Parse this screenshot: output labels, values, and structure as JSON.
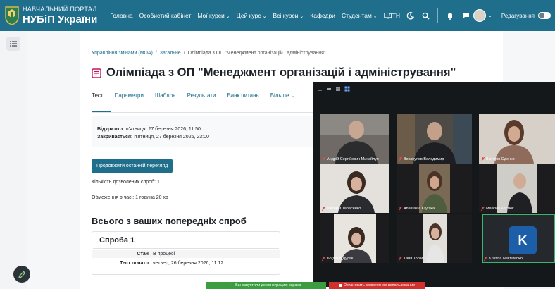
{
  "header": {
    "logo_top": "НАВЧАЛЬНИЙ ПОРТАЛ",
    "logo_bottom": "НУБіП України",
    "nav": [
      {
        "label": "Головна",
        "caret": ""
      },
      {
        "label": "Особистий кабінет",
        "caret": ""
      },
      {
        "label": "Мої курси",
        "caret": "⌄"
      },
      {
        "label": "Цей курс",
        "caret": "⌄"
      },
      {
        "label": "Всі курси",
        "caret": "⌄"
      },
      {
        "label": "Кафедри",
        "caret": ""
      },
      {
        "label": "Студентам",
        "caret": "⌄"
      },
      {
        "label": "ЦДТН",
        "caret": ""
      }
    ],
    "edit_mode_label": "Редагування",
    "avatar_caret": "⌄"
  },
  "breadcrumb": [
    "Управління змінами (МОА)",
    "Загальне",
    "Олімпіада з ОП \"Менеджмент організацій і адміністрування\""
  ],
  "page_title": "Олімпіада з ОП \"Менеджмент організацій і адміністрування\"",
  "tabs": [
    "Тест",
    "Параметри",
    "Шаблон",
    "Результати",
    "Банк питань",
    "Більше"
  ],
  "tab_more_caret": "⌄",
  "dates": {
    "open_label": "Відкрито з:",
    "open_value": "п'ятниця, 27 березня 2026, 11:50",
    "close_label": "Закривається:",
    "close_value": "п'ятниця, 27 березня 2026, 23:00"
  },
  "continue_button": "Продовжити останній перегляд",
  "attempts_allowed": "Кількість дозволених спроб: 1",
  "time_limit": "Обмеження в часі: 1 година 20 хв",
  "previous_attempts_heading": "Всього з ваших попередніх спроб",
  "attempt": {
    "title": "Спроба 1",
    "rows": [
      {
        "label": "Стан",
        "value": "В процесі"
      },
      {
        "label": "Тест почато",
        "value": "четвер, 26 березня 2026, 11:12"
      }
    ]
  },
  "video_call": {
    "participants": [
      {
        "name": "Андрій Сергійович Михайлук"
      },
      {
        "name": "Воскоулов Володимир"
      },
      {
        "name": "Вікторія Оденко"
      },
      {
        "name": "Вікторія Тарасенко"
      },
      {
        "name": "Anastasia Krytska"
      },
      {
        "name": "Максим Костюк"
      },
      {
        "name": "Богдана Дудяк"
      },
      {
        "name": "Таня Торій"
      },
      {
        "name": "Kristina Nekrutenko",
        "initial": "K"
      }
    ]
  },
  "share_banner": {
    "notice": "Вы запустили демонстрацию экрана",
    "stop": "Остановить совместное использование"
  },
  "colors": {
    "brand": "#1f6e8c",
    "call_bg": "#15181b",
    "share_green": "#3c9d40",
    "share_red": "#d0312d",
    "avatar_blue": "#1d5ea8"
  }
}
